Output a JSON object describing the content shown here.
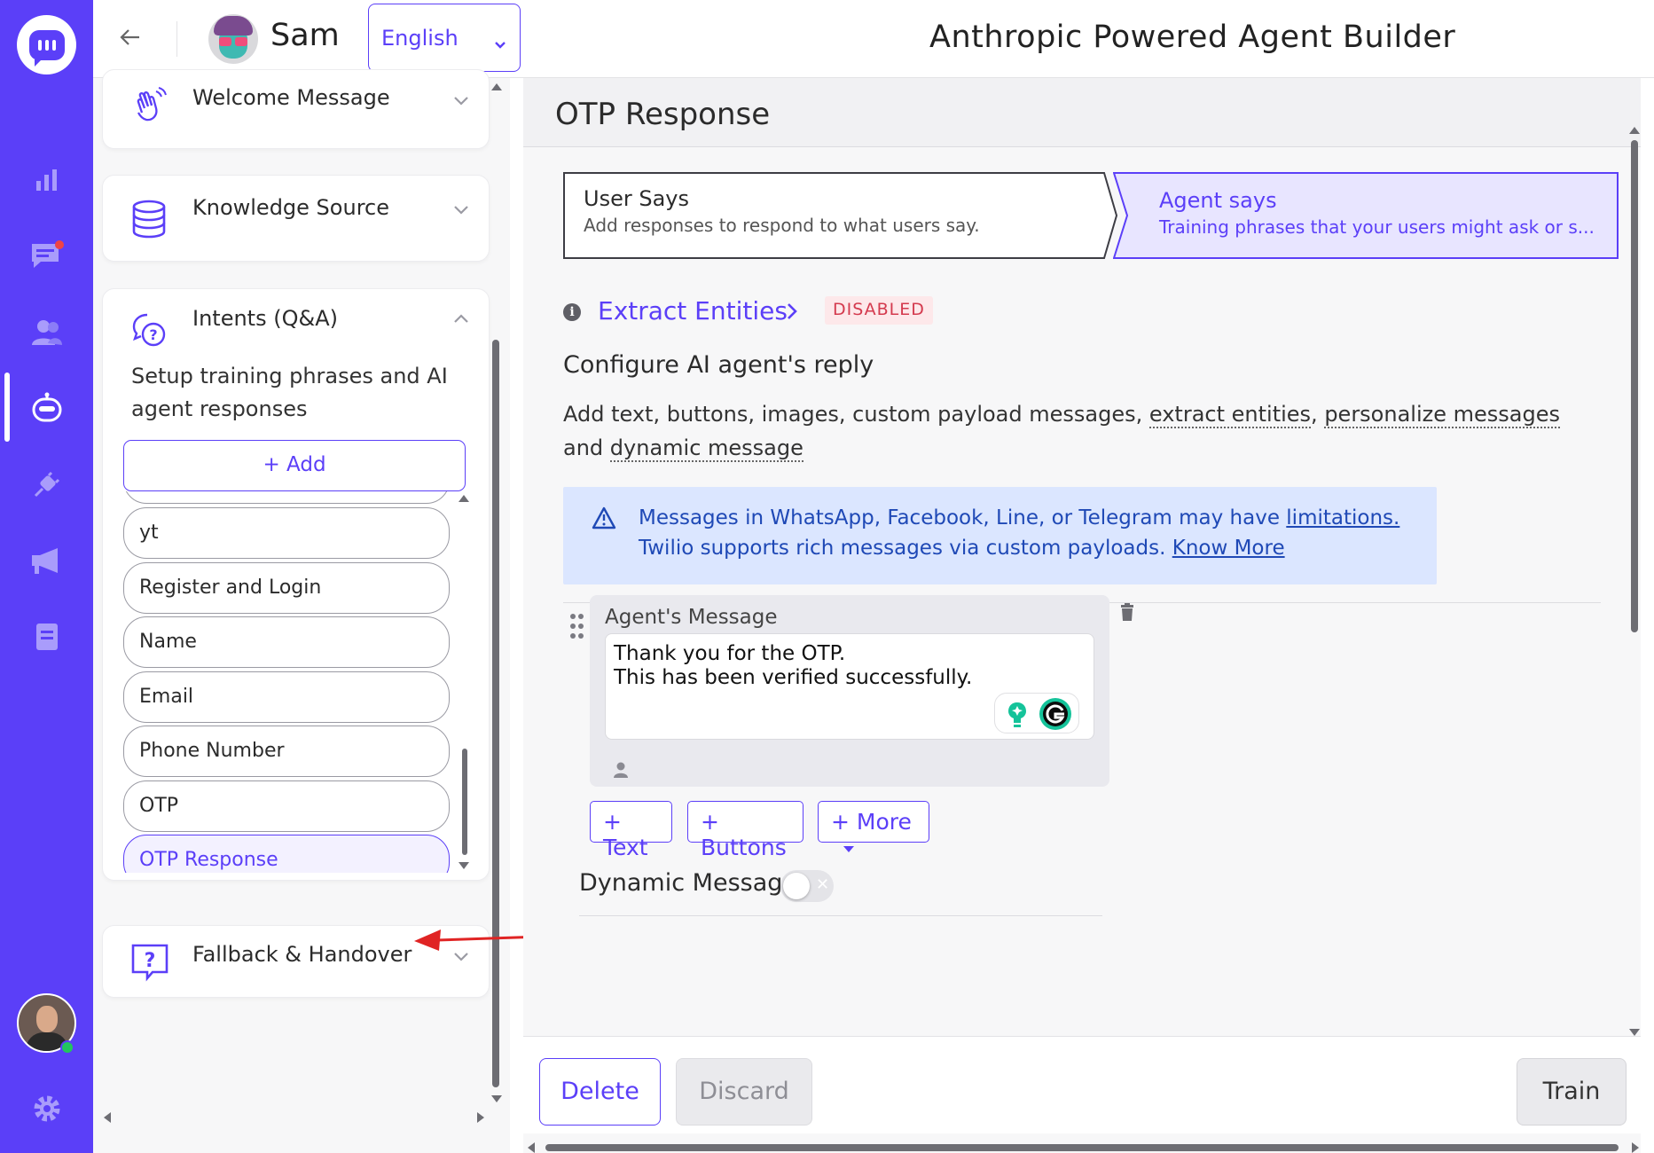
{
  "app": {
    "title": "Anthropic Powered Agent Builder",
    "brand_color": "#5b3ff8"
  },
  "rail": {
    "logo_icon": "chat-bubble-logo-icon",
    "items": [
      {
        "icon": "analytics-icon"
      },
      {
        "icon": "conversations-icon",
        "has_notification": true
      },
      {
        "icon": "users-icon"
      },
      {
        "icon": "bot-icon",
        "active": true
      },
      {
        "icon": "integrations-icon"
      },
      {
        "icon": "campaigns-icon"
      },
      {
        "icon": "docs-icon"
      }
    ],
    "settings_icon": "gear-icon",
    "user_online": true
  },
  "topbar": {
    "bot_name": "Sam",
    "language": "English"
  },
  "sidebar": {
    "sections": {
      "welcome": {
        "title": "Welcome Message"
      },
      "knowledge": {
        "title": "Knowledge Source"
      },
      "intents": {
        "title": "Intents (Q&A)",
        "description": "Setup training phrases and AI agent responses",
        "add_label": "+ Add",
        "items": [
          "yt",
          "Register and Login",
          "Name",
          "Email",
          "Phone Number",
          "OTP",
          "OTP Response"
        ],
        "active_item": "OTP Response"
      },
      "fallback": {
        "title": "Fallback & Handover"
      }
    }
  },
  "main": {
    "page_title": "OTP Response",
    "tabs": {
      "user_says": {
        "title": "User Says",
        "subtitle": "Add responses to respond to what users say."
      },
      "agent_says": {
        "title": "Agent says",
        "subtitle": "Training phrases that your users might ask or s..."
      }
    },
    "extract_entities": {
      "label": "Extract Entities",
      "badge": "DISABLED"
    },
    "config": {
      "title": "Configure AI agent's reply",
      "desc_prefix": "Add text, buttons, images, custom payload messages,",
      "link_extract": "extract entities",
      "link_personalize": "personalize messages",
      "word_and": "and",
      "link_dynamic": "dynamic message"
    },
    "alert": {
      "line1_text": "Messages in WhatsApp, Facebook, Line, or Telegram may have",
      "line1_link": "limitations.",
      "line2_text": "Twilio supports rich messages via custom payloads.",
      "line2_link": "Know More"
    },
    "agent_message": {
      "label": "Agent's Message",
      "line1": "Thank you for the OTP.",
      "line2": "This has been verified successfully."
    },
    "add_buttons": {
      "text": "+ Text",
      "buttons": "+ Buttons",
      "more": "+ More"
    },
    "dynamic_message": {
      "label": "Dynamic Message",
      "enabled": false
    }
  },
  "actions": {
    "delete": "Delete",
    "discard": "Discard",
    "train": "Train"
  }
}
